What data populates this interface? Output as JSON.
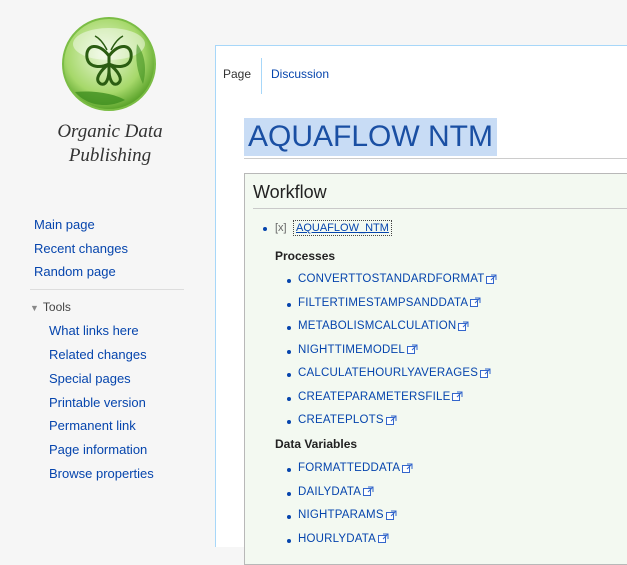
{
  "sidebar": {
    "logo_line1": "Organic Data",
    "logo_line2": "Publishing",
    "nav": [
      "Main page",
      "Recent changes",
      "Random page"
    ],
    "tools_label": "Tools",
    "tools": [
      "What links here",
      "Related changes",
      "Special pages",
      "Printable version",
      "Permanent link",
      "Page information",
      "Browse properties"
    ]
  },
  "tabs": {
    "page": "Page",
    "discussion": "Discussion"
  },
  "page_title": "AQUAFLOW NTM",
  "workflow": {
    "heading": "Workflow",
    "toggle": "[x]",
    "root": "AQUAFLOW_NTM",
    "processes_label": "Processes",
    "processes": [
      "CONVERTTOSTANDARDFORMAT",
      "FILTERTIMESTAMPSANDDATA",
      "METABOLISMCALCULATION",
      "NIGHTTIMEMODEL",
      "CALCULATEHOURLYAVERAGES",
      "CREATEPARAMETERSFILE",
      "CREATEPLOTS"
    ],
    "variables_label": "Data Variables",
    "variables": [
      "FORMATTEDDATA",
      "DAILYDATA",
      "NIGHTPARAMS",
      "HOURLYDATA"
    ]
  },
  "colors": {
    "link": "#0645ad",
    "title_highlight": "#c8dcf5",
    "workflow_bg": "#f3f9f1",
    "logo_green": "#6cbf3c"
  },
  "icons": {
    "external": "external-link-icon",
    "tools_arrow": "triangle-down-icon",
    "logo": "butterfly-logo-icon"
  }
}
